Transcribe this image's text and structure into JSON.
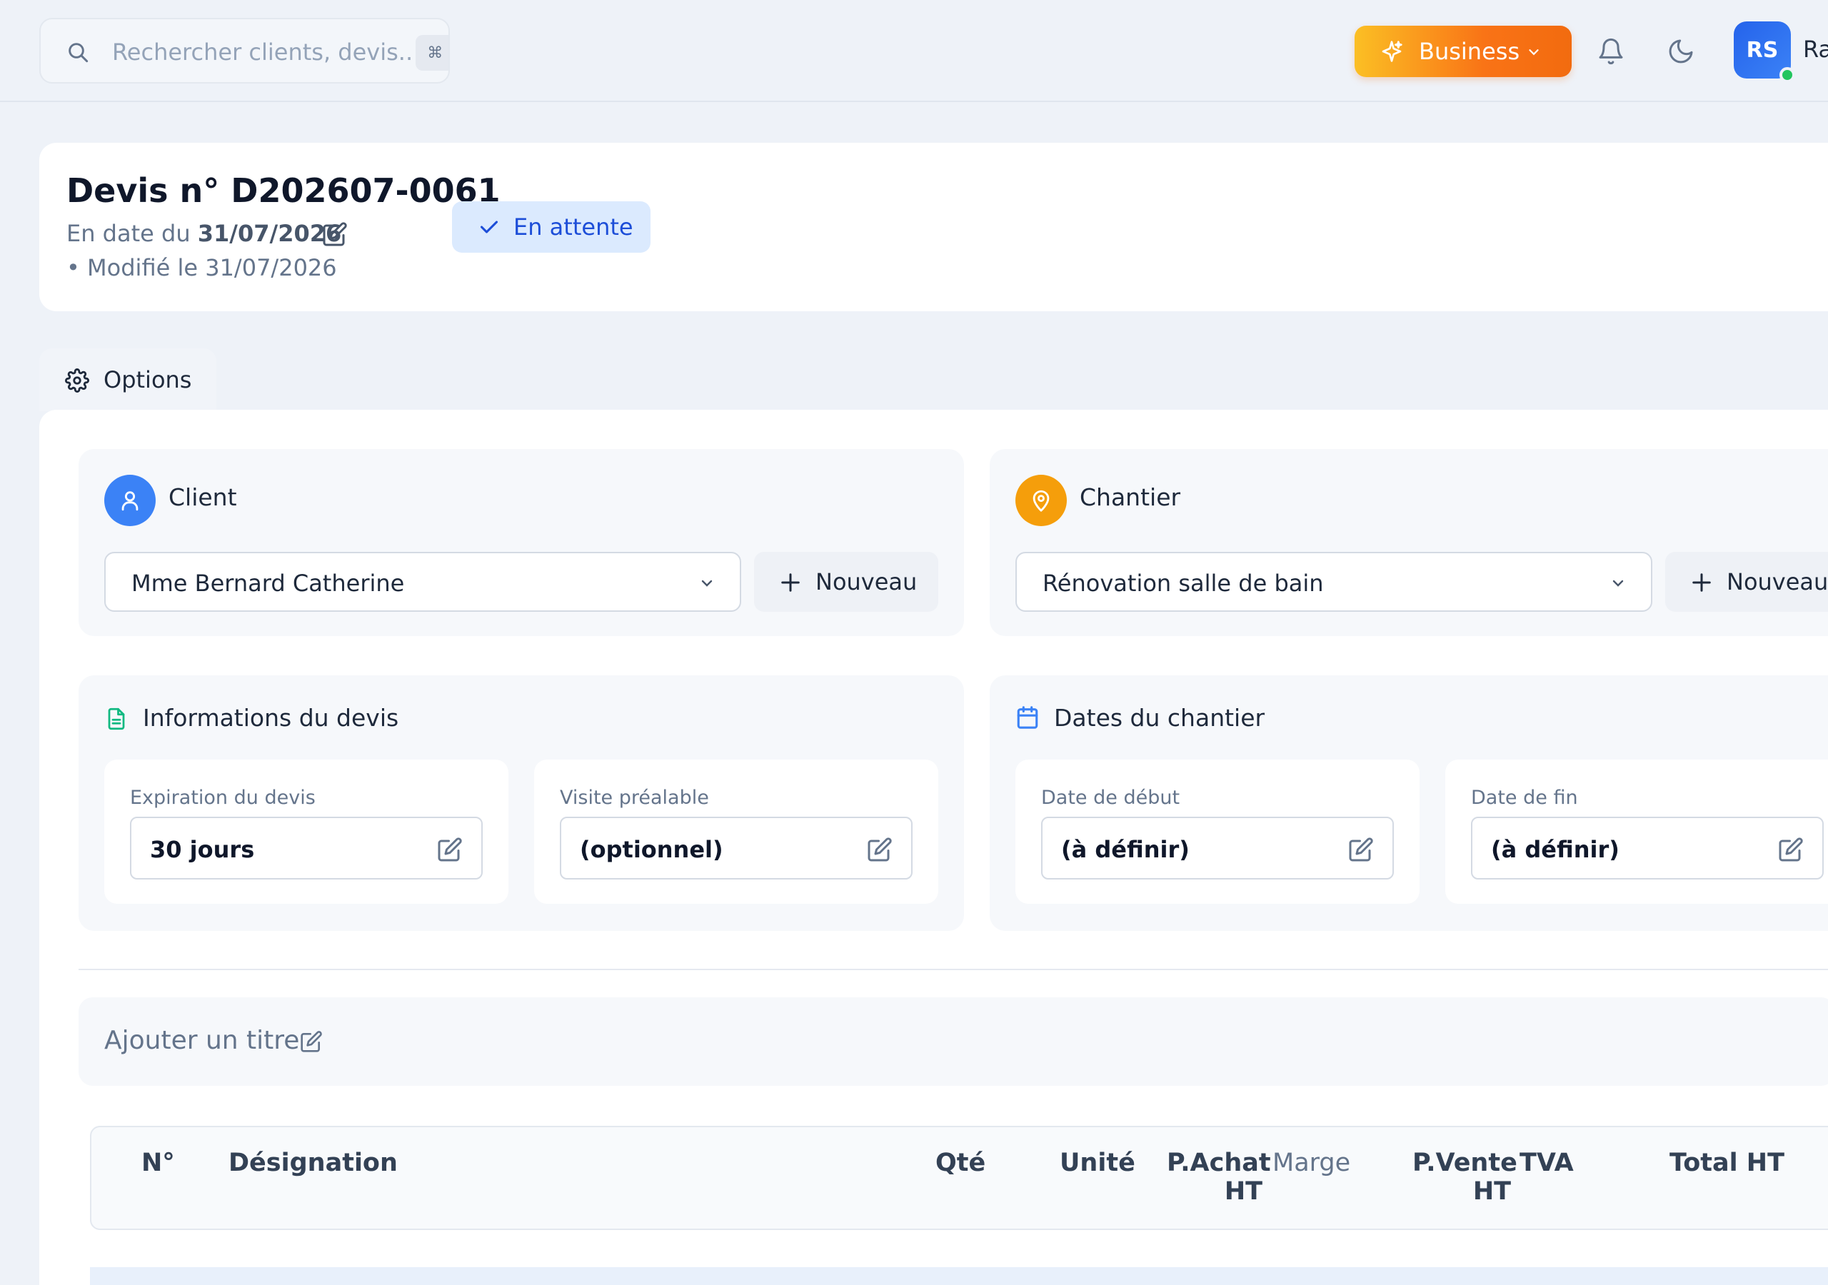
{
  "topbar": {
    "search_placeholder": "Rechercher clients, devis...",
    "search_shortcut": "⌘ K",
    "plan_label": "Business",
    "avatar_initials": "RS",
    "user_name": "Ra"
  },
  "quote": {
    "title": "Devis n° D202607-0061",
    "date_prefix": "En date du ",
    "date_value": "31/07/2026",
    "modified": "• Modifié le 31/07/2026",
    "status": "En attente"
  },
  "tabs": {
    "options_label": "Options"
  },
  "client": {
    "title": "Client",
    "selected": "Mme Bernard Catherine",
    "new_label": "Nouveau"
  },
  "chantier": {
    "title": "Chantier",
    "selected": "Rénovation salle de bain",
    "new_label": "Nouveau"
  },
  "infos": {
    "title": "Informations du devis",
    "expiration_label": "Expiration du devis",
    "expiration_value": "30 jours",
    "visite_label": "Visite préalable",
    "visite_value": "(optionnel)"
  },
  "dates": {
    "title": "Dates du chantier",
    "start_label": "Date de début",
    "start_value": "(à définir)",
    "end_label": "Date de fin",
    "end_value": "(à définir)"
  },
  "title_bar": {
    "label": "Ajouter un titre"
  },
  "table": {
    "columns": {
      "num": "N°",
      "designation": "Désignation",
      "qty": "Qté",
      "unit": "Unité",
      "pachat_1": "P.Achat",
      "pachat_2": "HT",
      "marge": "Marge",
      "pvente_1": "P.Vente",
      "pvente_2": "HT",
      "tva": "TVA",
      "total": "Total HT"
    }
  },
  "colors": {
    "accent_blue": "#2563eb",
    "accent_orange": "#f59e0b",
    "status_bg": "#dbeafe",
    "status_text": "#1d4ed8"
  }
}
